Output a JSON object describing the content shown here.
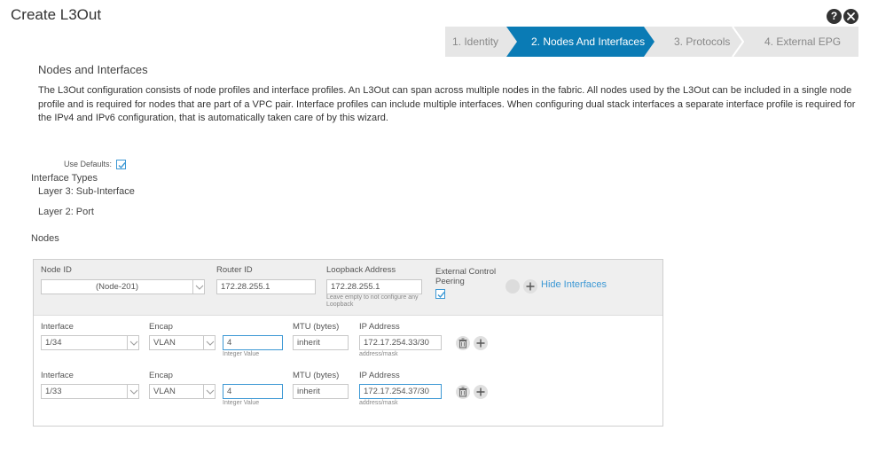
{
  "dialog": {
    "title": "Create L3Out",
    "help_glyph": "?",
    "close_glyph": "x"
  },
  "wizard": {
    "steps": [
      {
        "label": "1. Identity",
        "state": "done"
      },
      {
        "label": "2. Nodes And Interfaces",
        "state": "active"
      },
      {
        "label": "3. Protocols",
        "state": "pending"
      },
      {
        "label": "4. External EPG",
        "state": "pending"
      }
    ],
    "active_color": "#0a7bb5"
  },
  "section": {
    "title": "Nodes and Interfaces",
    "description": "The L3Out configuration consists of node profiles and interface profiles. An L3Out can span across multiple nodes in the fabric. All nodes used by the L3Out can be included in a single node profile and is required for nodes that are part of a VPC pair. Interface profiles can include multiple interfaces. When configuring dual stack interfaces a separate interface profile is required for the IPv4 and IPv6 configuration, that is automatically taken care of by this wizard."
  },
  "defaults": {
    "use_defaults_label": "Use Defaults:",
    "use_defaults_checked": true
  },
  "interface_types": {
    "title": "Interface Types",
    "layer3": "Layer 3: Sub-Interface",
    "layer2": "Layer 2: Port"
  },
  "nodes": {
    "title": "Nodes",
    "node_id_label": "Node ID",
    "node_id_value": "(Node-201)",
    "router_id_label": "Router ID",
    "router_id_value": "172.28.255.1",
    "loopback_label": "Loopback Address",
    "loopback_value": "172.28.255.1",
    "loopback_hint": "Leave empty to not configure any Loopback",
    "ext_ctrl_label_1": "External Control",
    "ext_ctrl_label_2": "Peering",
    "ext_ctrl_checked": true,
    "hide_interfaces": "Hide Interfaces"
  },
  "interfaces": [
    {
      "interface_label": "Interface",
      "interface_value": "1/34",
      "encap_label": "Encap",
      "encap_value": "VLAN",
      "encap_id": "4",
      "encap_hint": "Integer Value",
      "mtu_label": "MTU (bytes)",
      "mtu_value": "inherit",
      "ip_label": "IP Address",
      "ip_value": "172.17.254.33/30",
      "ip_hint": "address/mask"
    },
    {
      "interface_label": "Interface",
      "interface_value": "1/33",
      "encap_label": "Encap",
      "encap_value": "VLAN",
      "encap_id": "4",
      "encap_hint": "Integer Value",
      "mtu_label": "MTU (bytes)",
      "mtu_value": "inherit",
      "ip_label": "IP Address",
      "ip_value": "172.17.254.37/30",
      "ip_hint": "address/mask"
    }
  ],
  "icons": {
    "help": "help-icon",
    "close": "close-icon",
    "checkbox": "checkmark-icon",
    "dropdown": "chevron-down-icon",
    "trash": "trash-icon",
    "add": "plus-icon"
  }
}
